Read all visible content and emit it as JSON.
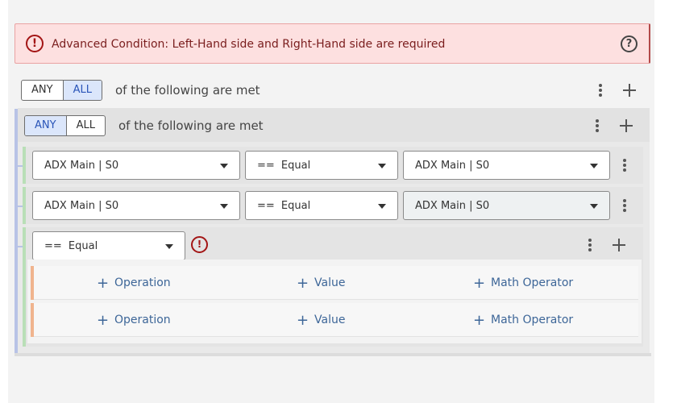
{
  "alert": {
    "message": "Advanced Condition: Left-Hand side and Right-Hand side are required",
    "icon": "!",
    "help_icon": "?"
  },
  "root_group": {
    "any_label": "ANY",
    "all_label": "ALL",
    "active": "ALL",
    "label": "of the following are met"
  },
  "nested_group": {
    "any_label": "ANY",
    "all_label": "ALL",
    "active": "ANY",
    "label": "of the following are met",
    "conditions": [
      {
        "lhs": "ADX Main | S0",
        "operator": "== Equal",
        "rhs": "ADX Main | S0"
      },
      {
        "lhs": "ADX Main | S0",
        "operator": "== Equal",
        "rhs": "ADX Main | S0"
      }
    ],
    "advanced": {
      "operator": "== Equal",
      "error_icon": "!",
      "rows": [
        {
          "operation": "Operation",
          "value": "Value",
          "math_operator": "Math Operator"
        },
        {
          "operation": "Operation",
          "value": "Value",
          "math_operator": "Math Operator"
        }
      ]
    }
  },
  "colors": {
    "alert_bg": "#fde0e0",
    "alert_text": "#7a1d1d",
    "error_red": "#a31515",
    "toggle_active_bg": "#dbe6fb",
    "toggle_active_text": "#2a55b8",
    "link_blue": "#3d6698",
    "group_rail": "#b8c3e6",
    "condition_rail": "#b9dfb7",
    "operation_rail": "#f0b48e"
  }
}
